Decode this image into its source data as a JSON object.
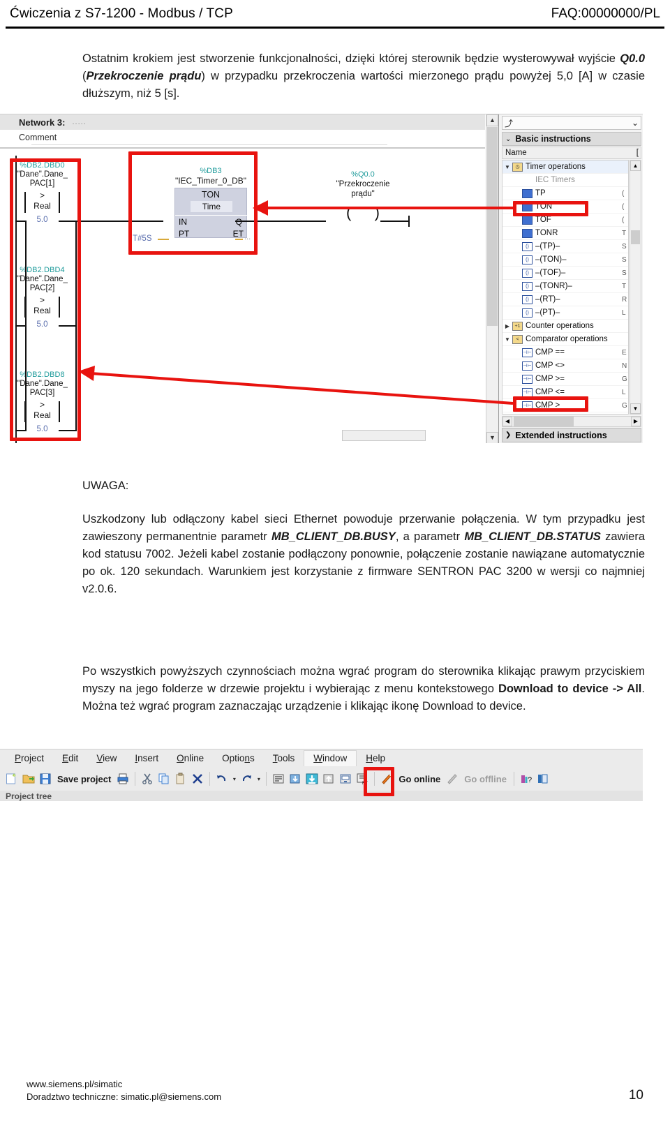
{
  "header": {
    "title": "Ćwiczenia z S7-1200 - Modbus / TCP",
    "faq": "FAQ:00000000/PL"
  },
  "paragraphs": {
    "intro_1": "Ostatnim krokiem jest stworzenie funkcjonalności, dzięki której sterownik będzie wysterowywał wyjście ",
    "intro_q": "Q0.0",
    "intro_2": " (",
    "intro_bold": "Przekroczenie prądu",
    "intro_3": ") w przypadku przekroczenia wartości mierzonego prądu powyżej 5,0 [A] w czasie dłuższym, niż 5 [s].",
    "uwaga_label": "UWAGA:",
    "uwaga_1": "Uszkodzony lub odłączony kabel sieci Ethernet powoduje przerwanie połączenia. W tym przypadku jest zawieszony permanentnie parametr ",
    "uwaga_busy": "MB_CLIENT_DB.BUSY",
    "uwaga_2": ", a parametr ",
    "uwaga_status": "MB_CLIENT_DB.STATUS",
    "uwaga_3": " zawiera kod statusu 7002. Jeżeli kabel zostanie podłączony ponownie, połączenie zostanie nawiązane automatycznie po ok. 120 sekundach. Warunkiem jest korzystanie z firmware SENTRON PAC 3200 w wersji co najmniej v2.0.6.",
    "download_1": "Po wszystkich powyższych czynnościach można wgrać program do sterownika klikając prawym przyciskiem myszy na jego folderze w drzewie projektu i wybierając z menu kontekstowego ",
    "download_bold": "Download to device -> All",
    "download_2": ". Można też wgrać program zaznaczając urządzenie i klikając ikonę Download to device."
  },
  "ladder_editor": {
    "network_title": "Network 3:",
    "network_dots": ".....",
    "comment": "Comment",
    "contacts": [
      {
        "addr": "%DB2.DBD0",
        "name_line1": "\"Dane\".Dane_",
        "name_line2": "PAC[1]",
        "op": ">",
        "type": "Real",
        "value": "5.0"
      },
      {
        "addr": "%DB2.DBD4",
        "name_line1": "\"Dane\".Dane_",
        "name_line2": "PAC[2]",
        "op": ">",
        "type": "Real",
        "value": "5.0"
      },
      {
        "addr": "%DB2.DBD8",
        "name_line1": "\"Dane\".Dane_",
        "name_line2": "PAC[3]",
        "op": ">",
        "type": "Real",
        "value": "5.0"
      }
    ],
    "timer": {
      "db": "%DB3",
      "instance": "\"IEC_Timer_0_DB\"",
      "name": "TON",
      "type": "Time",
      "in": "IN",
      "q": "Q",
      "pt": "PT",
      "et": "ET",
      "pt_value": "T#5S",
      "et_dots": "..."
    },
    "coil": {
      "addr": "%Q0.0",
      "name_line1": "\"Przekroczenie",
      "name_line2": "prądu\""
    }
  },
  "instructions_panel": {
    "toolbar_icon": "insert-instruction-icon",
    "title": "Basic instructions",
    "column_name": "Name",
    "column_desc": "[",
    "extended_title": "Extended instructions",
    "tree": [
      {
        "label": "Timer operations",
        "indent": 0,
        "arrow": "▼",
        "icon": "clock",
        "group": true
      },
      {
        "label": "IEC Timers",
        "indent": 1,
        "arrow": "",
        "icon": "",
        "muted": true
      },
      {
        "label": "TP",
        "indent": 1,
        "arrow": "",
        "icon": "block",
        "desc": "("
      },
      {
        "label": "TON",
        "indent": 1,
        "arrow": "",
        "icon": "block",
        "desc": "(",
        "highlight": true
      },
      {
        "label": "TOF",
        "indent": 1,
        "arrow": "",
        "icon": "block",
        "desc": "("
      },
      {
        "label": "TONR",
        "indent": 1,
        "arrow": "",
        "icon": "block",
        "desc": "T"
      },
      {
        "label": "–(TP)–",
        "indent": 1,
        "arrow": "",
        "icon": "coil",
        "desc": "S"
      },
      {
        "label": "–(TON)–",
        "indent": 1,
        "arrow": "",
        "icon": "coil",
        "desc": "S"
      },
      {
        "label": "–(TOF)–",
        "indent": 1,
        "arrow": "",
        "icon": "coil",
        "desc": "S"
      },
      {
        "label": "–(TONR)–",
        "indent": 1,
        "arrow": "",
        "icon": "coil",
        "desc": "T"
      },
      {
        "label": "–(RT)–",
        "indent": 1,
        "arrow": "",
        "icon": "coil",
        "desc": "R"
      },
      {
        "label": "–(PT)–",
        "indent": 1,
        "arrow": "",
        "icon": "coil",
        "desc": "L"
      },
      {
        "label": "Counter operations",
        "indent": 0,
        "arrow": "▶",
        "icon": "counter",
        "group": false
      },
      {
        "label": "Comparator operations",
        "indent": 0,
        "arrow": "▼",
        "icon": "comparator",
        "group": false
      },
      {
        "label": "CMP ==",
        "indent": 1,
        "arrow": "",
        "icon": "cmp",
        "desc": "E"
      },
      {
        "label": "CMP <>",
        "indent": 1,
        "arrow": "",
        "icon": "cmp",
        "desc": "N"
      },
      {
        "label": "CMP >=",
        "indent": 1,
        "arrow": "",
        "icon": "cmp",
        "desc": "G"
      },
      {
        "label": "CMP <=",
        "indent": 1,
        "arrow": "",
        "icon": "cmp",
        "desc": "L"
      },
      {
        "label": "CMP >",
        "indent": 1,
        "arrow": "",
        "icon": "cmp",
        "desc": "G",
        "highlight": true
      }
    ]
  },
  "tia_toolbar": {
    "menus": [
      {
        "label": "Project",
        "mnemonic": "P"
      },
      {
        "label": "Edit",
        "mnemonic": "E"
      },
      {
        "label": "View",
        "mnemonic": "V"
      },
      {
        "label": "Insert",
        "mnemonic": "I"
      },
      {
        "label": "Online",
        "mnemonic": "O"
      },
      {
        "label": "Options",
        "mnemonic": "n"
      },
      {
        "label": "Tools",
        "mnemonic": "T"
      },
      {
        "label": "Window",
        "mnemonic": "W",
        "active": true
      },
      {
        "label": "Help",
        "mnemonic": "H"
      }
    ],
    "save_project": "Save project",
    "go_online": "Go online",
    "go_offline": "Go offline",
    "project_tree_label": "Project tree",
    "icons": [
      "new-project-icon",
      "open-project-icon",
      "save-icon",
      "print-icon",
      "cut-icon",
      "copy-icon",
      "paste-icon",
      "delete-icon",
      "undo-icon",
      "redo-icon",
      "compile-icon",
      "download-to-device-icon",
      "download-highlighted-icon",
      "upload-from-device-icon",
      "start-simulation-icon",
      "start-rt-icon",
      "go-online-icon",
      "go-offline-icon",
      "help-icon",
      "search-icon"
    ]
  },
  "footer": {
    "line1": "www.siemens.pl/simatic",
    "line2": "Doradztwo techniczne: simatic.pl@siemens.com",
    "page": "10"
  },
  "colors": {
    "annotation_red": "#e8130f",
    "tag_teal": "#1f9b9b",
    "value_blue": "#5b6fae",
    "block_fill": "#cfd2e0"
  }
}
